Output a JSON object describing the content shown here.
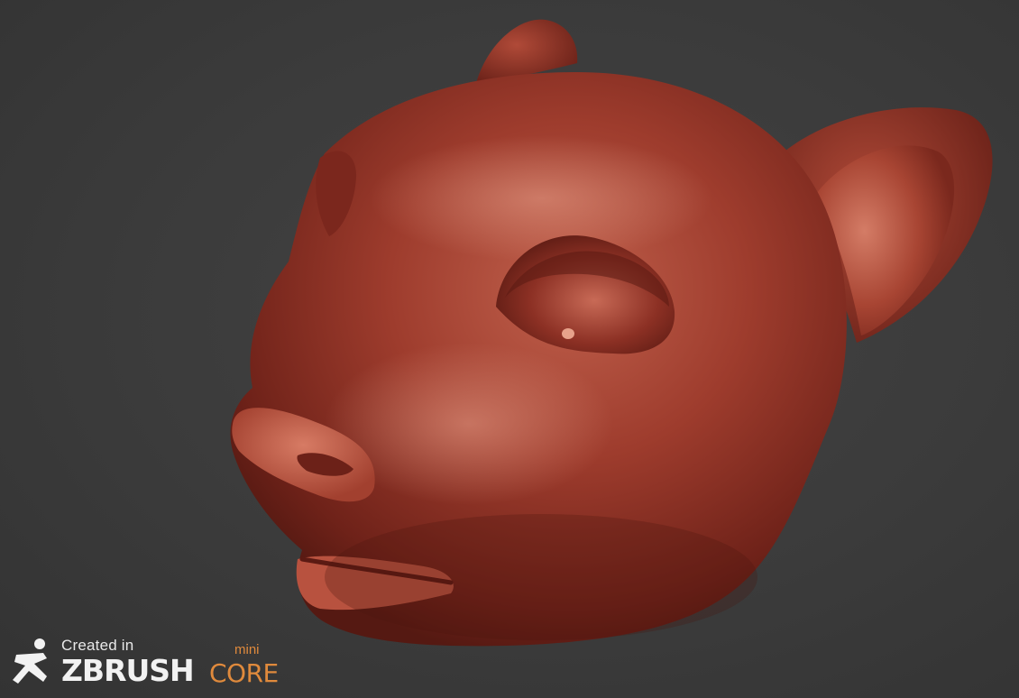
{
  "viewport": {
    "background_color": "#3a3a3a",
    "model_color": "#9b3a2c",
    "subject": "sculpted-feline-head"
  },
  "watermark": {
    "created_in": "Created in",
    "brand": "ZBRUSH",
    "core": "CORE",
    "mini": "mini",
    "icon": "zbrush-figure-icon",
    "accent_color": "#e08a3c"
  }
}
